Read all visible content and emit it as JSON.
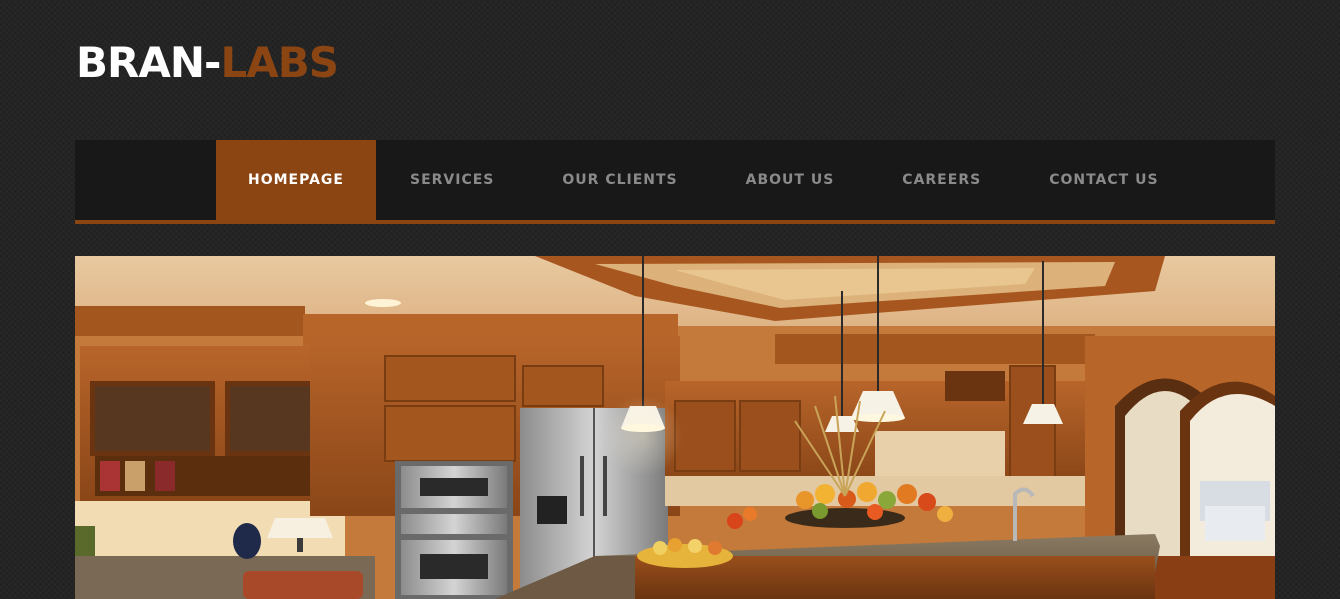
{
  "logo": {
    "part_a": "BRAN-",
    "part_b": "LABS"
  },
  "nav": {
    "items": [
      {
        "label": "HOMEPAGE",
        "active": true
      },
      {
        "label": "SERVICES",
        "active": false
      },
      {
        "label": "OUR CLIENTS",
        "active": false
      },
      {
        "label": "ABOUT US",
        "active": false
      },
      {
        "label": "CAREERS",
        "active": false
      },
      {
        "label": "CONTACT US",
        "active": false
      }
    ]
  },
  "hero": {
    "image_subject": "kitchen-interior"
  },
  "colors": {
    "background": "#242424",
    "navbar": "#181818",
    "accent": "#8b4513",
    "nav_text": "#8a8a8a",
    "logo_primary": "#ffffff"
  }
}
